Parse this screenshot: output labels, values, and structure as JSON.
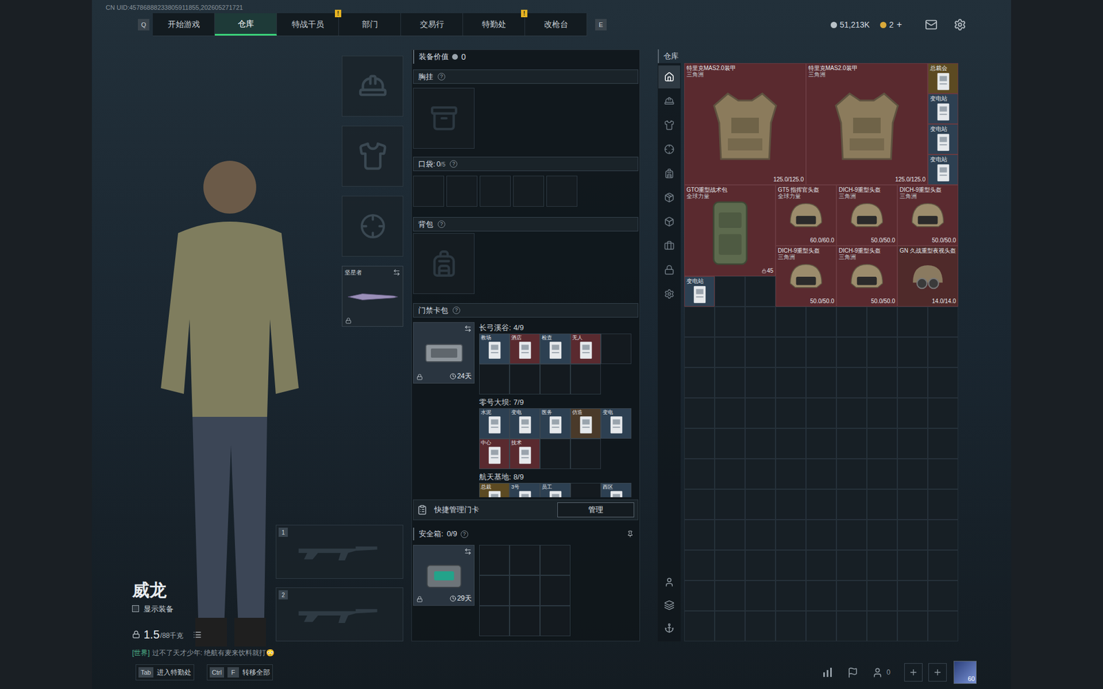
{
  "uid": "CN UID:45786888233805911855,202605271721",
  "nav": {
    "left_key": "Q",
    "right_key": "E",
    "alert_mark": "!",
    "tabs": [
      {
        "label": "开始游戏",
        "selected": false,
        "alert": false
      },
      {
        "label": "仓库",
        "selected": true,
        "alert": false
      },
      {
        "label": "特战干员",
        "selected": false,
        "alert": true
      },
      {
        "label": "部门",
        "selected": false,
        "alert": false
      },
      {
        "label": "交易行",
        "selected": false,
        "alert": false
      },
      {
        "label": "特勤处",
        "selected": false,
        "alert": true
      },
      {
        "label": "改枪台",
        "selected": false,
        "alert": false
      }
    ]
  },
  "currency": {
    "coins": "51,213K",
    "gold": "2",
    "add": "+"
  },
  "operator": {
    "name": "威龙",
    "show_equipment": {
      "label": "显示装备",
      "checked": false
    },
    "weight": "1.5",
    "weight_max": "/88千克"
  },
  "chat": {
    "channel": "[世界]",
    "text": "过不了天才少年: 绝航有麦来饮料就打😳"
  },
  "equip_slots": [
    {
      "kind": "helmet"
    },
    {
      "kind": "armor"
    },
    {
      "kind": "pistol"
    }
  ],
  "melee": {
    "label": "坚星者",
    "locked": true
  },
  "weapon_slots": [
    {
      "number": "1"
    },
    {
      "number": "2"
    }
  ],
  "loadout": {
    "value_label": "装备价值",
    "value": "0",
    "help": "?",
    "chest_rig": {
      "title": "胸挂"
    },
    "pockets": {
      "title": "口袋:",
      "count": "0",
      "capacity": "/5",
      "slot_count": 5
    },
    "backpack": {
      "title": "背包"
    },
    "keycard_case": {
      "title": "门禁卡包",
      "timer": "24天",
      "locked": true,
      "maps": [
        {
          "name": "长弓溪谷:",
          "count": "4/9",
          "slots": [
            {
              "filled": true,
              "label": "教场",
              "color": "#2d4052"
            },
            {
              "filled": true,
              "label": "酒店",
              "color": "#5a2a2f"
            },
            {
              "filled": true,
              "label": "检查",
              "color": "#2d4052"
            },
            {
              "filled": true,
              "label": "无人",
              "color": "#5a2a2f"
            },
            {
              "filled": false
            },
            {
              "filled": false
            },
            {
              "filled": false
            },
            {
              "filled": false
            },
            {
              "filled": false
            }
          ]
        },
        {
          "name": "零号大坝:",
          "count": "7/9",
          "slots": [
            {
              "filled": true,
              "label": "水泥",
              "color": "#2d4052"
            },
            {
              "filled": true,
              "label": "变电",
              "color": "#2d4052"
            },
            {
              "filled": true,
              "label": "医务",
              "color": "#2d4052"
            },
            {
              "filled": true,
              "label": "仿造",
              "color": "#4a3a2a"
            },
            {
              "filled": true,
              "label": "变电",
              "color": "#2d4052"
            },
            {
              "filled": true,
              "label": "中心",
              "color": "#5a2a2f"
            },
            {
              "filled": true,
              "label": "技术",
              "color": "#5a2a2f"
            },
            {
              "filled": false
            },
            {
              "filled": false
            }
          ]
        },
        {
          "name": "航天基地:",
          "count": "8/9",
          "slots": [
            {
              "filled": true,
              "label": "总裁",
              "color": "#5c4a22"
            },
            {
              "filled": true,
              "label": "3号",
              "color": "#2d4052"
            },
            {
              "filled": true,
              "label": "员工",
              "color": "#2d4052"
            },
            {
              "filled": false
            },
            {
              "filled": true,
              "label": "西区",
              "color": "#2d4052"
            }
          ]
        }
      ]
    },
    "quick_manage": {
      "label": "快捷管理门卡",
      "button": "管理"
    },
    "safe_box": {
      "title": "安全箱:",
      "count": "0/9",
      "timer": "29天",
      "locked": true,
      "slot_count": 9
    }
  },
  "warehouse": {
    "title": "仓库",
    "columns": 9,
    "rows": 19,
    "side_tabs": [
      {
        "selected": true
      },
      {
        "selected": false
      },
      {
        "selected": false
      },
      {
        "selected": false
      },
      {
        "selected": false
      },
      {
        "selected": false
      },
      {
        "selected": false
      },
      {
        "selected": false
      },
      {
        "selected": false
      },
      {
        "selected": false
      }
    ],
    "items": [
      {
        "kind": "armor",
        "name": "特里克MAS2.0装甲",
        "sub": "三角洲",
        "durability": "125.0/125.0",
        "color": "#5a2a2f",
        "col": 0,
        "row": 0,
        "w": 4,
        "h": 4
      },
      {
        "kind": "armor",
        "name": "特里克MAS2.0装甲",
        "sub": "三角洲",
        "durability": "125.0/125.0",
        "color": "#5a2a2f",
        "col": 4,
        "row": 0,
        "w": 4,
        "h": 4
      },
      {
        "kind": "card",
        "name": "总裁会",
        "color": "#5c4a22",
        "col": 8,
        "row": 0,
        "w": 1,
        "h": 1
      },
      {
        "kind": "card",
        "name": "变电站",
        "color": "#2d4052",
        "col": 8,
        "row": 1,
        "w": 1,
        "h": 1
      },
      {
        "kind": "card",
        "name": "变电站",
        "color": "#2d4052",
        "col": 8,
        "row": 2,
        "w": 1,
        "h": 1
      },
      {
        "kind": "card",
        "name": "变电站",
        "color": "#2d4052",
        "col": 8,
        "row": 3,
        "w": 1,
        "h": 1
      },
      {
        "kind": "backpack",
        "name": "GTO重型战术包",
        "sub": "全球力量",
        "badge": "45",
        "color": "#5a2a2f",
        "col": 0,
        "row": 4,
        "w": 3,
        "h": 3
      },
      {
        "kind": "helmet",
        "name": "GT5 指挥官头盔",
        "sub": "全球力量",
        "durability": "60.0/60.0",
        "color": "#5a2a2f",
        "col": 3,
        "row": 4,
        "w": 2,
        "h": 2
      },
      {
        "kind": "helmet",
        "name": "DICH-9重型头盔",
        "sub": "三角洲",
        "durability": "50.0/50.0",
        "color": "#5a2a2f",
        "col": 5,
        "row": 4,
        "w": 2,
        "h": 2
      },
      {
        "kind": "helmet",
        "name": "DICH-9重型头盔",
        "sub": "三角洲",
        "durability": "50.0/50.0",
        "color": "#5a2a2f",
        "col": 7,
        "row": 4,
        "w": 2,
        "h": 2
      },
      {
        "kind": "card",
        "name": "变电站",
        "color": "#2d4052",
        "col": 0,
        "row": 7,
        "w": 1,
        "h": 1
      },
      {
        "kind": "helmet",
        "name": "DICH-9重型头盔",
        "sub": "三角洲",
        "durability": "50.0/50.0",
        "color": "#5a2a2f",
        "col": 3,
        "row": 6,
        "w": 2,
        "h": 2
      },
      {
        "kind": "helmet",
        "name": "DICH-9重型头盔",
        "sub": "三角洲",
        "durability": "50.0/50.0",
        "color": "#5a2a2f",
        "col": 5,
        "row": 6,
        "w": 2,
        "h": 2
      },
      {
        "kind": "nvg",
        "name": "GN 久战重型夜视头盔",
        "durability": "14.0/14.0",
        "color": "#4f2a2a",
        "col": 7,
        "row": 6,
        "w": 2,
        "h": 2
      }
    ]
  },
  "hints": [
    {
      "keys": [
        "Tab"
      ],
      "label": "进入特勤处"
    },
    {
      "keys": [
        "Ctrl",
        "F"
      ],
      "label": "转移全部"
    }
  ],
  "social": {
    "friends": "0",
    "level": "60"
  }
}
